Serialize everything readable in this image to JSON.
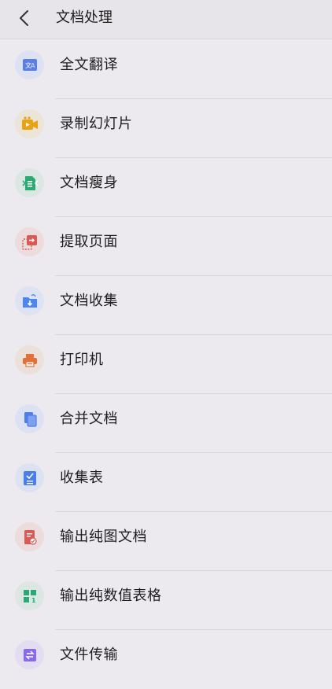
{
  "header": {
    "title": "文档处理"
  },
  "items": [
    {
      "label": "全文翻译",
      "icon": "translate-icon",
      "color": "#5b7fe6",
      "bg": "#dde2f3"
    },
    {
      "label": "录制幻灯片",
      "icon": "video-camera-icon",
      "color": "#e7a313",
      "bg": "#ece4d6"
    },
    {
      "label": "文档瘦身",
      "icon": "compress-doc-icon",
      "color": "#2bab74",
      "bg": "#dbe7e3"
    },
    {
      "label": "提取页面",
      "icon": "extract-page-icon",
      "color": "#d95a54",
      "bg": "#eddcdd"
    },
    {
      "label": "文档收集",
      "icon": "folder-collect-icon",
      "color": "#4d86f0",
      "bg": "#dde3f3"
    },
    {
      "label": "打印机",
      "icon": "printer-icon",
      "color": "#e2703a",
      "bg": "#ece0da"
    },
    {
      "label": "合并文档",
      "icon": "merge-docs-icon",
      "color": "#4f7ee8",
      "bg": "#dde2f3"
    },
    {
      "label": "收集表",
      "icon": "checklist-icon",
      "color": "#4a7fea",
      "bg": "#dde2f3"
    },
    {
      "label": "输出纯图文档",
      "icon": "image-doc-icon",
      "color": "#d95a54",
      "bg": "#eddcdd"
    },
    {
      "label": "输出纯数值表格",
      "icon": "table-grid-icon",
      "color": "#2ba875",
      "bg": "#dbe7e3"
    },
    {
      "label": "文件传输",
      "icon": "file-transfer-icon",
      "color": "#8a6ae6",
      "bg": "#e2ddf2"
    }
  ]
}
